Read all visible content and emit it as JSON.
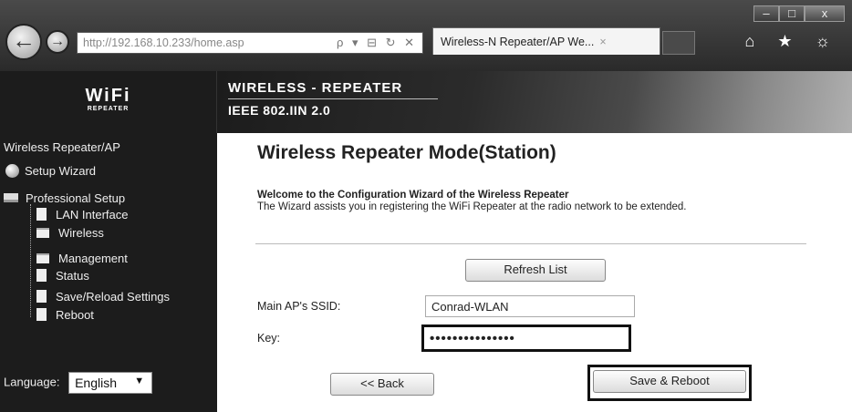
{
  "browser": {
    "url_host": "http://192.168.10.233",
    "url_path": "/home.asp",
    "url_tools": "ρ ▾ ⊟ ↻ ✕",
    "tab_title": "Wireless-N Repeater/AP We...",
    "tab_close": "×",
    "min": "–",
    "max": "□",
    "close": "x",
    "back_glyph": "←",
    "fwd_glyph": "→",
    "right_icons": "⌂ ★ ☼"
  },
  "logo": {
    "wifi": "WiFi",
    "repeater": "REPEATER"
  },
  "banner": {
    "line1": "WIRELESS - REPEATER",
    "line2": "IEEE 802.IIN 2.0"
  },
  "sidebar": {
    "header": "Wireless Repeater/AP",
    "items": [
      {
        "label": "Setup Wizard",
        "icon": "globe-icon"
      },
      {
        "label": "Professional Setup",
        "icon": "computer-icon"
      },
      {
        "label": "LAN Interface",
        "icon": "document-icon"
      },
      {
        "label": "Wireless",
        "icon": "folder-icon"
      },
      {
        "label": "Management",
        "icon": "folder-icon"
      },
      {
        "label": "Status",
        "icon": "document-icon"
      },
      {
        "label": "Save/Reload Settings",
        "icon": "document-icon"
      },
      {
        "label": "Reboot",
        "icon": "document-icon"
      }
    ],
    "language_label": "Language:",
    "language_value": "English",
    "language_arrow": "▼"
  },
  "main": {
    "title": "Wireless Repeater Mode(Station)",
    "intro_bold": "Welcome to the Configuration Wizard of the Wireless Repeater",
    "intro_text": "The Wizard assists you in registering the WiFi Repeater at the radio network to be extended.",
    "refresh_label": "Refresh List",
    "ssid_label": "Main AP's SSID:",
    "ssid_value": "Conrad-WLAN",
    "key_label": "Key:",
    "key_value": "•••••••••••••••",
    "back_label": "<< Back",
    "save_label": "Save & Reboot"
  }
}
